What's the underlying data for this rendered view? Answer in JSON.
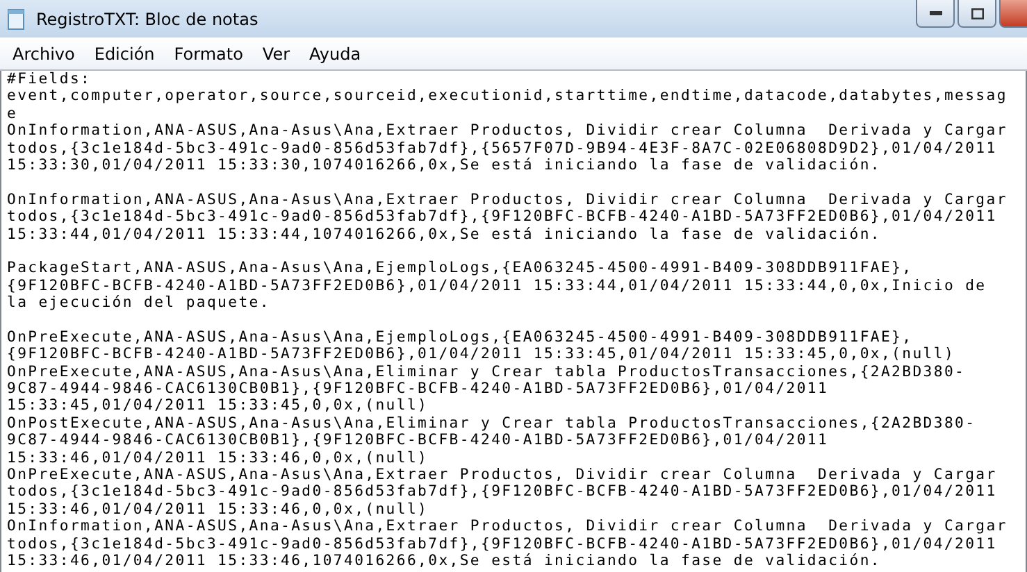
{
  "window": {
    "title": "RegistroTXT: Bloc de notas"
  },
  "menu": [
    "Archivo",
    "Edición",
    "Formato",
    "Ver",
    "Ayuda"
  ],
  "document": {
    "blocks": [
      {
        "lines": [
          "#Fields:",
          "event,computer,operator,source,sourceid,executionid,starttime,endtime,datacode,databytes,messag",
          "e",
          "OnInformation,ANA-ASUS,Ana-Asus\\Ana,Extraer Productos, Dividir crear Columna  Derivada y Cargar",
          "todos,{3c1e184d-5bc3-491c-9ad0-856d53fab7df},{5657F07D-9B94-4E3F-8A7C-02E06808D9D2},01/04/2011",
          "15:33:30,01/04/2011 15:33:30,1074016266,0x,Se está iniciando la fase de validación."
        ]
      },
      {
        "lines": [
          "OnInformation,ANA-ASUS,Ana-Asus\\Ana,Extraer Productos, Dividir crear Columna  Derivada y Cargar",
          "todos,{3c1e184d-5bc3-491c-9ad0-856d53fab7df},{9F120BFC-BCFB-4240-A1BD-5A73FF2ED0B6},01/04/2011",
          "15:33:44,01/04/2011 15:33:44,1074016266,0x,Se está iniciando la fase de validación."
        ]
      },
      {
        "lines": [
          "PackageStart,ANA-ASUS,Ana-Asus\\Ana,EjemploLogs,{EA063245-4500-4991-B409-308DDB911FAE},",
          "{9F120BFC-BCFB-4240-A1BD-5A73FF2ED0B6},01/04/2011 15:33:44,01/04/2011 15:33:44,0,0x,Inicio de",
          "la ejecución del paquete."
        ]
      },
      {
        "lines": [
          "OnPreExecute,ANA-ASUS,Ana-Asus\\Ana,EjemploLogs,{EA063245-4500-4991-B409-308DDB911FAE},",
          "{9F120BFC-BCFB-4240-A1BD-5A73FF2ED0B6},01/04/2011 15:33:45,01/04/2011 15:33:45,0,0x,(null)",
          "OnPreExecute,ANA-ASUS,Ana-Asus\\Ana,Eliminar y Crear tabla ProductosTransacciones,{2A2BD380-",
          "9C87-4944-9846-CAC6130CB0B1},{9F120BFC-BCFB-4240-A1BD-5A73FF2ED0B6},01/04/2011",
          "15:33:45,01/04/2011 15:33:45,0,0x,(null)",
          "OnPostExecute,ANA-ASUS,Ana-Asus\\Ana,Eliminar y Crear tabla ProductosTransacciones,{2A2BD380-",
          "9C87-4944-9846-CAC6130CB0B1},{9F120BFC-BCFB-4240-A1BD-5A73FF2ED0B6},01/04/2011",
          "15:33:46,01/04/2011 15:33:46,0,0x,(null)",
          "OnPreExecute,ANA-ASUS,Ana-Asus\\Ana,Extraer Productos, Dividir crear Columna  Derivada y Cargar",
          "todos,{3c1e184d-5bc3-491c-9ad0-856d53fab7df},{9F120BFC-BCFB-4240-A1BD-5A73FF2ED0B6},01/04/2011",
          "15:33:46,01/04/2011 15:33:46,0,0x,(null)",
          "OnInformation,ANA-ASUS,Ana-Asus\\Ana,Extraer Productos, Dividir crear Columna  Derivada y Cargar",
          "todos,{3c1e184d-5bc3-491c-9ad0-856d53fab7df},{9F120BFC-BCFB-4240-A1BD-5A73FF2ED0B6},01/04/2011",
          "15:33:46,01/04/2011 15:33:46,1074016266,0x,Se está iniciando la fase de validación."
        ]
      }
    ]
  }
}
